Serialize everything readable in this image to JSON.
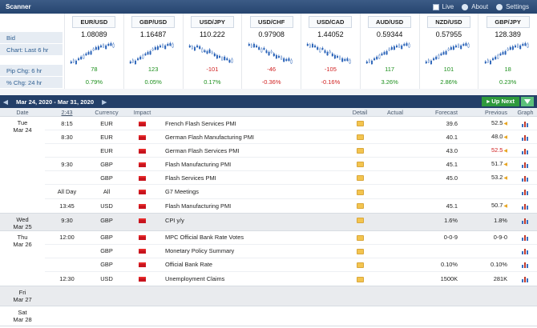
{
  "scanner": {
    "title": "Scanner",
    "live": "Live",
    "about": "About",
    "settings": "Settings",
    "row_labels": [
      "Bid",
      "Chart: Last 6 hr",
      "Pip Chg: 6 hr",
      "% Chg: 24 hr"
    ],
    "pairs": [
      {
        "name": "EUR/USD",
        "bid": "1.08089",
        "pip": "78",
        "pct": "0.79%",
        "dir": "up"
      },
      {
        "name": "GBP/USD",
        "bid": "1.16487",
        "pip": "123",
        "pct": "0.05%",
        "dir": "up"
      },
      {
        "name": "USD/JPY",
        "bid": "110.222",
        "pip": "-101",
        "pct": "0.17%",
        "dir": "mix"
      },
      {
        "name": "USD/CHF",
        "bid": "0.97908",
        "pip": "-46",
        "pct": "-0.36%",
        "dir": "down"
      },
      {
        "name": "USD/CAD",
        "bid": "1.44052",
        "pip": "-105",
        "pct": "-0.16%",
        "dir": "down"
      },
      {
        "name": "AUD/USD",
        "bid": "0.59344",
        "pip": "117",
        "pct": "3.26%",
        "dir": "up"
      },
      {
        "name": "NZD/USD",
        "bid": "0.57955",
        "pip": "101",
        "pct": "2.86%",
        "dir": "up"
      },
      {
        "name": "GBP/JPY",
        "bid": "128.389",
        "pip": "18",
        "pct": "0.23%",
        "dir": "up"
      }
    ]
  },
  "calendar": {
    "range": "Mar 24, 2020 - Mar 31, 2020",
    "up_next": "Up Next",
    "headers": {
      "date": "Date",
      "time": "2:43",
      "currency": "Currency",
      "impact": "Impact",
      "detail": "Detail",
      "actual": "Actual",
      "forecast": "Forecast",
      "previous": "Previous",
      "graph": "Graph"
    },
    "days": [
      {
        "dow": "Tue",
        "date": "Mar 24",
        "alt": false,
        "events": [
          {
            "time": "8:15",
            "cur": "EUR",
            "event": "French Flash Services PMI",
            "actual": "",
            "forecast": "39.6",
            "previous": "52.5",
            "prev_mark": true,
            "prev_red": false
          },
          {
            "time": "8:30",
            "cur": "EUR",
            "event": "German Flash Manufacturing PMI",
            "actual": "",
            "forecast": "40.1",
            "previous": "48.0",
            "prev_mark": true,
            "prev_red": false
          },
          {
            "time": "",
            "cur": "EUR",
            "event": "German Flash Services PMI",
            "actual": "",
            "forecast": "43.0",
            "previous": "52.5",
            "prev_mark": true,
            "prev_red": true
          },
          {
            "time": "9:30",
            "cur": "GBP",
            "event": "Flash Manufacturing PMI",
            "actual": "",
            "forecast": "45.1",
            "previous": "51.7",
            "prev_mark": true,
            "prev_red": false
          },
          {
            "time": "",
            "cur": "GBP",
            "event": "Flash Services PMI",
            "actual": "",
            "forecast": "45.0",
            "previous": "53.2",
            "prev_mark": true,
            "prev_red": false
          },
          {
            "time": "All Day",
            "cur": "All",
            "event": "G7 Meetings",
            "actual": "",
            "forecast": "",
            "previous": "",
            "prev_mark": false,
            "prev_red": false
          },
          {
            "time": "13:45",
            "cur": "USD",
            "event": "Flash Manufacturing PMI",
            "actual": "",
            "forecast": "45.1",
            "previous": "50.7",
            "prev_mark": true,
            "prev_red": false
          }
        ]
      },
      {
        "dow": "Wed",
        "date": "Mar 25",
        "alt": true,
        "events": [
          {
            "time": "9:30",
            "cur": "GBP",
            "event": "CPI y/y",
            "actual": "",
            "forecast": "1.6%",
            "previous": "1.8%",
            "prev_mark": false,
            "prev_red": false
          }
        ]
      },
      {
        "dow": "Thu",
        "date": "Mar 26",
        "alt": false,
        "events": [
          {
            "time": "12:00",
            "cur": "GBP",
            "event": "MPC Official Bank Rate Votes",
            "actual": "",
            "forecast": "0-0-9",
            "previous": "0-9-0",
            "prev_mark": false,
            "prev_red": false
          },
          {
            "time": "",
            "cur": "GBP",
            "event": "Monetary Policy Summary",
            "actual": "",
            "forecast": "",
            "previous": "",
            "prev_mark": false,
            "prev_red": false
          },
          {
            "time": "",
            "cur": "GBP",
            "event": "Official Bank Rate",
            "actual": "",
            "forecast": "0.10%",
            "previous": "0.10%",
            "prev_mark": false,
            "prev_red": false
          },
          {
            "time": "12:30",
            "cur": "USD",
            "event": "Unemployment Claims",
            "actual": "",
            "forecast": "1500K",
            "previous": "281K",
            "prev_mark": false,
            "prev_red": false
          }
        ]
      },
      {
        "dow": "Fri",
        "date": "Mar 27",
        "alt": true,
        "events": []
      },
      {
        "dow": "Sat",
        "date": "Mar 28",
        "alt": false,
        "events": []
      }
    ]
  }
}
